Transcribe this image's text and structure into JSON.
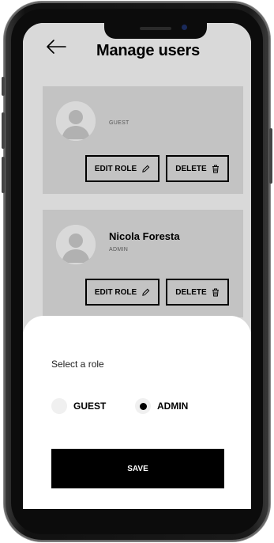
{
  "header": {
    "back_icon": "arrow-left-icon",
    "title": "Manage users"
  },
  "users": [
    {
      "name": "",
      "role": "GUEST",
      "edit_label": "EDIT ROLE",
      "edit_icon": "pencil-icon",
      "delete_label": "DELETE",
      "delete_icon": "trash-icon"
    },
    {
      "name": "Nicola Foresta",
      "role": "ADMIN",
      "edit_label": "EDIT ROLE",
      "edit_icon": "pencil-icon",
      "delete_label": "DELETE",
      "delete_icon": "trash-icon"
    }
  ],
  "role_sheet": {
    "title": "Select a role",
    "options": [
      {
        "label": "GUEST",
        "selected": false
      },
      {
        "label": "ADMIN",
        "selected": true
      }
    ],
    "save_label": "SAVE"
  },
  "colors": {
    "primary": "#000000",
    "card": "#e6e6e6",
    "background": "#ffffff"
  }
}
